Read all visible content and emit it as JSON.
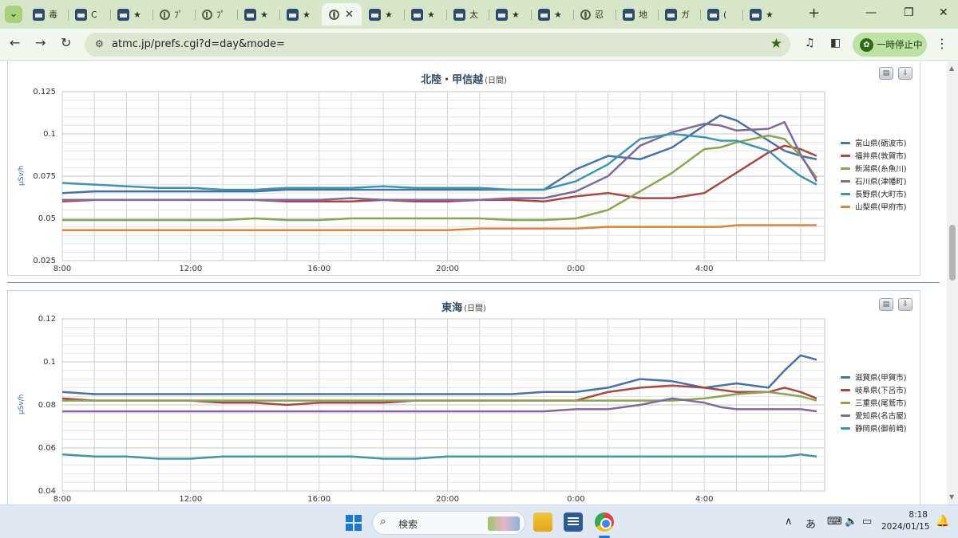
{
  "browser": {
    "tabs": [
      {
        "title": "毒",
        "icon": "site-favicon-icon",
        "active": false
      },
      {
        "title": "C",
        "icon": "site-favicon-icon",
        "active": false
      },
      {
        "title": "★",
        "icon": "site-favicon-icon",
        "active": false
      },
      {
        "title": "ﾌﾟ",
        "icon": "half-circle-favicon-icon",
        "active": false
      },
      {
        "title": "ﾌﾟ",
        "icon": "half-circle-favicon-icon",
        "active": false
      },
      {
        "title": "★",
        "icon": "site-favicon-icon",
        "active": false
      },
      {
        "title": "★",
        "icon": "site-favicon-icon",
        "active": false
      },
      {
        "title": "",
        "icon": "globe-icon",
        "active": true
      },
      {
        "title": "★",
        "icon": "site-favicon-icon",
        "active": false
      },
      {
        "title": "★",
        "icon": "site-favicon-icon",
        "active": false
      },
      {
        "title": "太",
        "icon": "site-favicon-icon",
        "active": false
      },
      {
        "title": "★",
        "icon": "site-favicon-icon",
        "active": false
      },
      {
        "title": "★",
        "icon": "site-favicon-icon",
        "active": false
      },
      {
        "title": "忍",
        "icon": "globe-icon",
        "active": false
      },
      {
        "title": "地",
        "icon": "site-favicon-icon",
        "active": false
      },
      {
        "title": "ガ",
        "icon": "site-favicon-icon",
        "active": false
      },
      {
        "title": "(",
        "icon": "site-favicon-icon",
        "active": false
      },
      {
        "title": "★",
        "icon": "site-favicon-icon",
        "active": false
      }
    ],
    "url": "atmc.jp/prefs.cgi?d=day&mode=",
    "pause_label": "一時停止中",
    "theme_color": "#d5e7c8"
  },
  "charts": [
    {
      "title": "北陸・甲信越",
      "subtitle": "(日間)",
      "chart_data": {
        "type": "line",
        "title": "北陸・甲信越 (日間)",
        "ylabel": "µSv/h",
        "ylim": [
          0.025,
          0.125
        ],
        "yticks": [
          0.025,
          0.05,
          0.075,
          0.1,
          0.125
        ],
        "x": [
          "8:00",
          "9:00",
          "10:00",
          "11:00",
          "12:00",
          "13:00",
          "14:00",
          "15:00",
          "16:00",
          "17:00",
          "18:00",
          "19:00",
          "20:00",
          "21:00",
          "22:00",
          "23:00",
          "0:00",
          "1:00",
          "2:00",
          "3:00",
          "4:00",
          "4:30",
          "5:00",
          "6:00",
          "6:30",
          "7:00",
          "7:30"
        ],
        "xticks": [
          "8:00",
          "12:00",
          "16:00",
          "20:00",
          "0:00",
          "4:00"
        ],
        "series": [
          {
            "name": "富山県(砺波市)",
            "color": "#4572a7",
            "values": [
              0.065,
              0.066,
              0.066,
              0.066,
              0.066,
              0.066,
              0.066,
              0.067,
              0.067,
              0.067,
              0.067,
              0.067,
              0.067,
              0.067,
              0.067,
              0.067,
              0.079,
              0.087,
              0.085,
              0.092,
              0.105,
              0.111,
              0.108,
              0.096,
              0.09,
              0.087,
              0.085
            ]
          },
          {
            "name": "福井県(敦賀市)",
            "color": "#aa4643",
            "values": [
              0.06,
              0.061,
              0.061,
              0.061,
              0.061,
              0.061,
              0.061,
              0.06,
              0.06,
              0.06,
              0.061,
              0.06,
              0.06,
              0.061,
              0.061,
              0.06,
              0.063,
              0.065,
              0.062,
              0.062,
              0.065,
              0.071,
              0.077,
              0.089,
              0.093,
              0.091,
              0.087
            ]
          },
          {
            "name": "新潟県(糸魚川)",
            "color": "#89a54e",
            "values": [
              0.049,
              0.049,
              0.049,
              0.049,
              0.049,
              0.049,
              0.05,
              0.049,
              0.049,
              0.05,
              0.05,
              0.05,
              0.05,
              0.05,
              0.049,
              0.049,
              0.05,
              0.055,
              0.066,
              0.077,
              0.091,
              0.092,
              0.095,
              0.099,
              0.097,
              0.087,
              0.074
            ]
          },
          {
            "name": "石川県(津幡町)",
            "color": "#80699b",
            "values": [
              0.061,
              0.061,
              0.061,
              0.061,
              0.061,
              0.061,
              0.061,
              0.061,
              0.061,
              0.062,
              0.061,
              0.061,
              0.061,
              0.061,
              0.062,
              0.062,
              0.066,
              0.075,
              0.093,
              0.101,
              0.106,
              0.105,
              0.102,
              0.103,
              0.107,
              0.088,
              0.072
            ]
          },
          {
            "name": "長野県(大町市)",
            "color": "#3d96ae",
            "values": [
              0.071,
              0.07,
              0.069,
              0.068,
              0.068,
              0.067,
              0.067,
              0.068,
              0.068,
              0.068,
              0.069,
              0.068,
              0.068,
              0.068,
              0.067,
              0.067,
              0.072,
              0.082,
              0.097,
              0.1,
              0.098,
              0.096,
              0.096,
              0.09,
              0.082,
              0.075,
              0.07
            ]
          },
          {
            "name": "山梨県(甲府市)",
            "color": "#db843d",
            "values": [
              0.043,
              0.043,
              0.043,
              0.043,
              0.043,
              0.043,
              0.043,
              0.043,
              0.043,
              0.043,
              0.043,
              0.043,
              0.043,
              0.044,
              0.044,
              0.044,
              0.044,
              0.045,
              0.045,
              0.045,
              0.045,
              0.045,
              0.046,
              0.046,
              0.046,
              0.046,
              0.046
            ]
          }
        ]
      }
    },
    {
      "title": "東海",
      "subtitle": "(日間)",
      "chart_data": {
        "type": "line",
        "title": "東海 (日間)",
        "ylabel": "µSv/h",
        "ylim": [
          0.04,
          0.12
        ],
        "yticks": [
          0.04,
          0.06,
          0.08,
          0.1,
          0.12
        ],
        "x": [
          "8:00",
          "9:00",
          "10:00",
          "11:00",
          "12:00",
          "13:00",
          "14:00",
          "15:00",
          "16:00",
          "17:00",
          "18:00",
          "19:00",
          "20:00",
          "21:00",
          "22:00",
          "23:00",
          "0:00",
          "1:00",
          "2:00",
          "3:00",
          "4:00",
          "4:30",
          "5:00",
          "6:00",
          "6:30",
          "7:00",
          "7:30"
        ],
        "xticks": [
          "8:00",
          "12:00",
          "16:00",
          "20:00",
          "0:00",
          "4:00"
        ],
        "series": [
          {
            "name": "滋賀県(甲賀市)",
            "color": "#4572a7",
            "values": [
              0.086,
              0.085,
              0.085,
              0.085,
              0.085,
              0.085,
              0.085,
              0.085,
              0.085,
              0.085,
              0.085,
              0.085,
              0.085,
              0.085,
              0.085,
              0.086,
              0.086,
              0.088,
              0.092,
              0.091,
              0.088,
              0.089,
              0.09,
              0.088,
              0.096,
              0.103,
              0.101
            ]
          },
          {
            "name": "岐阜県(下呂市)",
            "color": "#aa4643",
            "values": [
              0.083,
              0.082,
              0.082,
              0.082,
              0.082,
              0.081,
              0.081,
              0.08,
              0.081,
              0.081,
              0.081,
              0.082,
              0.082,
              0.082,
              0.082,
              0.082,
              0.082,
              0.086,
              0.088,
              0.089,
              0.088,
              0.087,
              0.086,
              0.086,
              0.088,
              0.086,
              0.083
            ]
          },
          {
            "name": "三重県(尾鷲市)",
            "color": "#89a54e",
            "values": [
              0.082,
              0.082,
              0.082,
              0.082,
              0.082,
              0.082,
              0.082,
              0.082,
              0.082,
              0.082,
              0.082,
              0.082,
              0.082,
              0.082,
              0.082,
              0.082,
              0.082,
              0.082,
              0.082,
              0.082,
              0.083,
              0.084,
              0.085,
              0.086,
              0.085,
              0.084,
              0.082
            ]
          },
          {
            "name": "愛知県(名古屋)",
            "color": "#80699b",
            "values": [
              0.077,
              0.077,
              0.077,
              0.077,
              0.077,
              0.077,
              0.077,
              0.077,
              0.077,
              0.077,
              0.077,
              0.077,
              0.077,
              0.077,
              0.077,
              0.077,
              0.078,
              0.078,
              0.08,
              0.083,
              0.081,
              0.079,
              0.078,
              0.078,
              0.078,
              0.078,
              0.077
            ]
          },
          {
            "name": "静岡県(御前崎)",
            "color": "#3d96ae",
            "values": [
              0.057,
              0.056,
              0.056,
              0.055,
              0.055,
              0.056,
              0.056,
              0.056,
              0.056,
              0.056,
              0.055,
              0.055,
              0.056,
              0.056,
              0.056,
              0.056,
              0.056,
              0.056,
              0.056,
              0.056,
              0.056,
              0.056,
              0.056,
              0.056,
              0.056,
              0.057,
              0.056
            ]
          }
        ]
      }
    }
  ],
  "taskbar": {
    "search_placeholder": "検索",
    "ime_indicator": "あ",
    "time": "8:18",
    "date": "2024/01/15"
  }
}
